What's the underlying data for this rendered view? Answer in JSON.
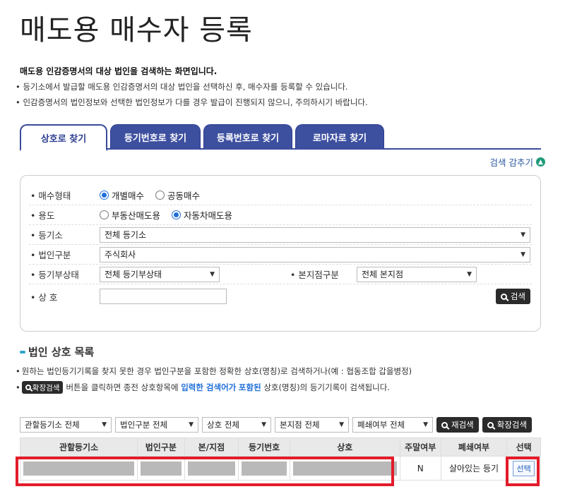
{
  "title": "매도용 매수자 등록",
  "intro": {
    "heading": "매도용 인감증명서의 대상 법인을 검색하는 화면입니다.",
    "lines": [
      "등기소에서 발급할 매도용 인감증명서의 대상 법인을 선택하신 후, 매수자를 등록할 수 있습니다.",
      "인감증명서의 법인정보와 선택한 법인정보가 다를 경우 발급이 진행되지 않으니, 주의하시기 바랍니다."
    ]
  },
  "tabs": [
    "상호로 찾기",
    "등기번호로 찾기",
    "등록번호로 찾기",
    "로마자로 찾기"
  ],
  "toggle_search": "검색 감추기",
  "form": {
    "buyer_type": {
      "label": "매수형태",
      "options": [
        "개별매수",
        "공동매수"
      ],
      "selected": "개별매수"
    },
    "purpose": {
      "label": "용도",
      "options": [
        "부동산매도용",
        "자동차매도용"
      ],
      "selected": "자동차매도용"
    },
    "registry": {
      "label": "등기소",
      "value": "전체 등기소"
    },
    "corp_type": {
      "label": "법인구분",
      "value": "주식회사"
    },
    "reg_status": {
      "label": "등기부상태",
      "value": "전체 등기부상태"
    },
    "branch": {
      "label": "본지점구분",
      "value": "전체 본지점"
    },
    "name": {
      "label": "상 호",
      "value": ""
    },
    "search_button": "검색"
  },
  "list": {
    "title": "법인 상호 목록",
    "note1": "원하는 법인등기기록을 찾지 못한 경우 법인구분을 포함한 정확한 상호(명칭)로 검색하거나(예 : 협동조합 갑을병정)",
    "note2": {
      "button": "확장검색",
      "part1": "버튼을 클릭하면 종전 상호항목에",
      "highlight1": "입력한 검색어가",
      "highlight2": "포함된",
      "part2": "상호(명칭)의 등기기록이 검색됩니다."
    }
  },
  "filters": [
    "관할등기소 전체",
    "법인구분 전체",
    "상호 전체",
    "본지점 전체",
    "폐쇄여부 전체"
  ],
  "filter_buttons": [
    "재검색",
    "확장검색"
  ],
  "table": {
    "headers": [
      "관할등기소",
      "법인구분",
      "본/지점",
      "등기번호",
      "상호",
      "주말여부",
      "폐쇄여부",
      "선택"
    ],
    "rows": [
      {
        "weekend": "N",
        "closed": "살아있는 등기",
        "select": "선택"
      }
    ]
  },
  "colors": {
    "tab_blue": "#3d4f9f",
    "highlight_red": "#e21c2a",
    "accent_blue": "#1e6fd8"
  }
}
